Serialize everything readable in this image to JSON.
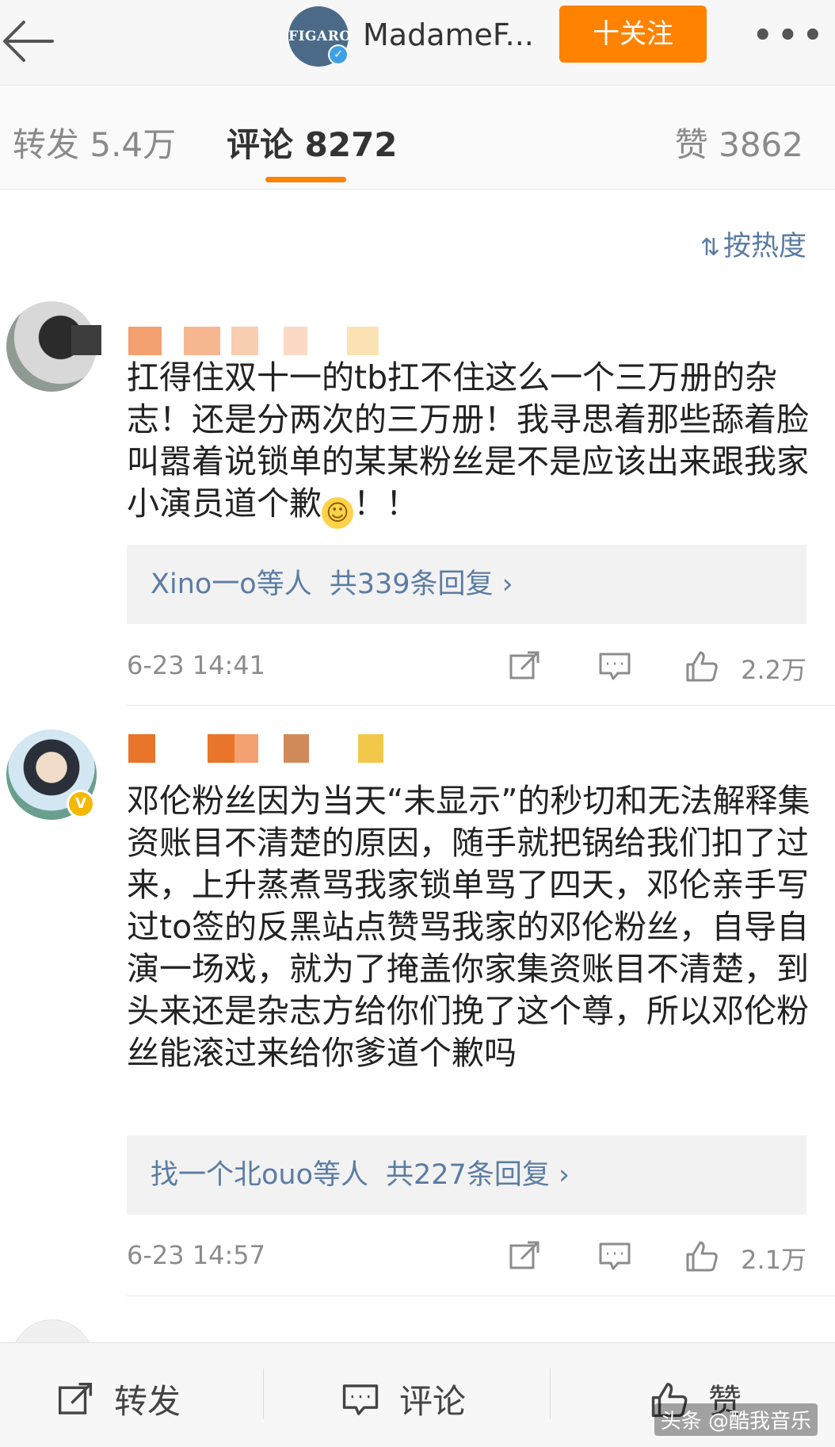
{
  "header": {
    "account_name": "MadameF...",
    "avatar_text": "FIGARO",
    "follow_label": "十关注",
    "more_label": "•••"
  },
  "tabs": {
    "repost": "转发 5.4万",
    "comment": "评论 8272",
    "like": "赞 3862"
  },
  "sort": {
    "icon": "sort-icon",
    "label": "按热度"
  },
  "comments": [
    {
      "text": "扛得住双十一的tb扛不住这么一个三万册的杂志！还是分两次的三万册！我寻思着那些舔着脸叫嚣着说锁单的某某粉丝是不是应该出来跟我家小演员道个歉",
      "text_suffix": "！！",
      "reply_users": "Xino一o等人",
      "reply_count": "共339条回复 ›",
      "time": "6-23 14:41",
      "likes": "2.2万"
    },
    {
      "text": "邓伦粉丝因为当天“未显示”的秒切和无法解释集资账目不清楚的原因，随手就把锅给我们扣了过来，上升蒸煮骂我家锁单骂了四天，邓伦亲手写过to签的反黑站点赞骂我家的邓伦粉丝，自导自演一场戏，就为了掩盖你家集资账目不清楚，到头来还是杂志方给你们挽了这个尊，所以邓伦粉丝能滚过来给你爹道个歉吗",
      "reply_users": "找一个北ouo等人",
      "reply_count": "共227条回复 ›",
      "time": "6-23 14:57",
      "likes": "2.1万"
    }
  ],
  "bottom_bar": {
    "repost": "转发",
    "comment": "评论",
    "like": "赞"
  },
  "watermark": "头条 @酷我音乐",
  "colors": {
    "accent_orange": "#ff8200",
    "link_blue": "#5b7ca3",
    "muted_gray": "#8c8c8c"
  }
}
